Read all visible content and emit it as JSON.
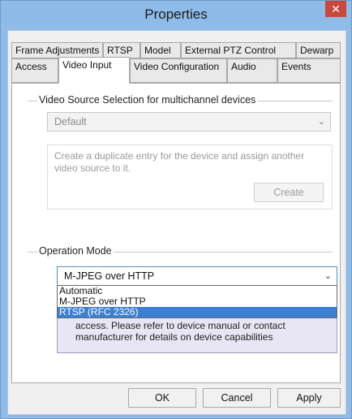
{
  "window": {
    "title": "Properties",
    "close_glyph": "✕"
  },
  "tabs": {
    "row1": [
      "Frame Adjustments",
      "RTSP",
      "Model",
      "External PTZ Control",
      "Dewarp"
    ],
    "row2": [
      "Access",
      "Video Input",
      "Video Configuration",
      "Audio",
      "Events"
    ],
    "selected": "Video Input"
  },
  "video_source": {
    "group_label": "Video Source Selection for multichannel devices",
    "selected_value": "Default",
    "description_line1": "Create a duplicate entry for the device and assign another",
    "description_line2": "video source to it.",
    "create_label": "Create"
  },
  "operation_mode": {
    "group_label": "Operation Mode",
    "selected_value": "M-JPEG over HTTP",
    "options": [
      "Automatic",
      "M-JPEG over HTTP",
      "RTSP (RFC 2326)"
    ],
    "highlighted_option": "RTSP (RFC 2326)",
    "info_line1": "access. Please refer to device manual or contact",
    "info_line2": "manufacturer for details on device capabilities"
  },
  "buttons": {
    "ok": "OK",
    "cancel": "Cancel",
    "apply": "Apply"
  },
  "colors": {
    "titlebar": "#8fbbe8",
    "close": "#c9483c",
    "highlight": "#3a7fd4"
  }
}
